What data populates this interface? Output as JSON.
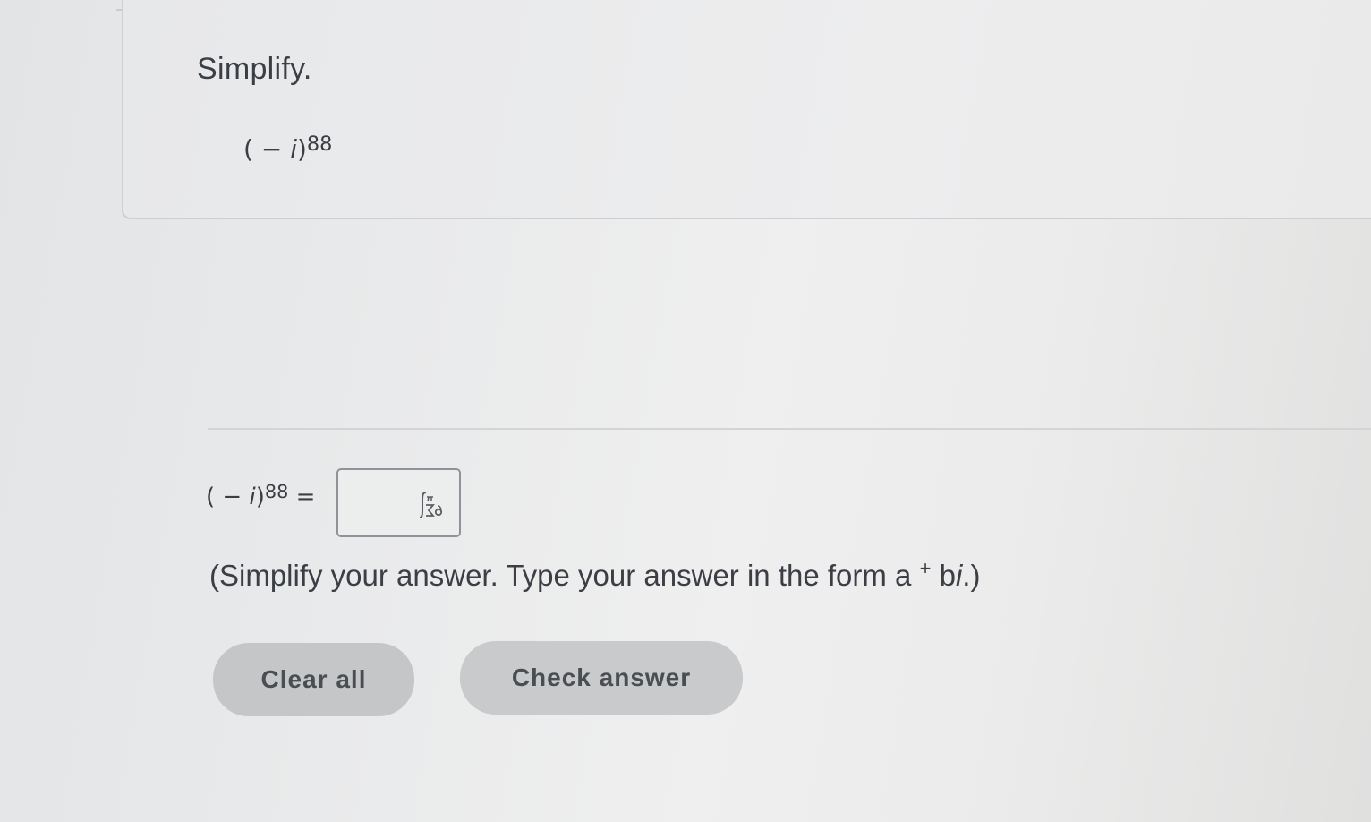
{
  "question": {
    "prompt": "Simplify.",
    "expression": {
      "base_open": "( − ",
      "variable": "i",
      "base_close": ")",
      "exponent": "88"
    }
  },
  "answer": {
    "lhs": {
      "base_open": "( − ",
      "variable": "i",
      "base_close": ")",
      "exponent": "88",
      "equals": " ="
    },
    "input_value": "",
    "input_icon": "math-palette-icon",
    "instructions": {
      "before": "(Simplify your answer. Type your answer in the form a",
      "plus": "+",
      "b": "b",
      "i": "i",
      "after": ".)"
    }
  },
  "buttons": {
    "clear_label": "Clear all",
    "check_label": "Check answer"
  },
  "colors": {
    "text": "#3a3d42",
    "button_bg": "#c4c6c8",
    "input_border": "#8f9297"
  }
}
